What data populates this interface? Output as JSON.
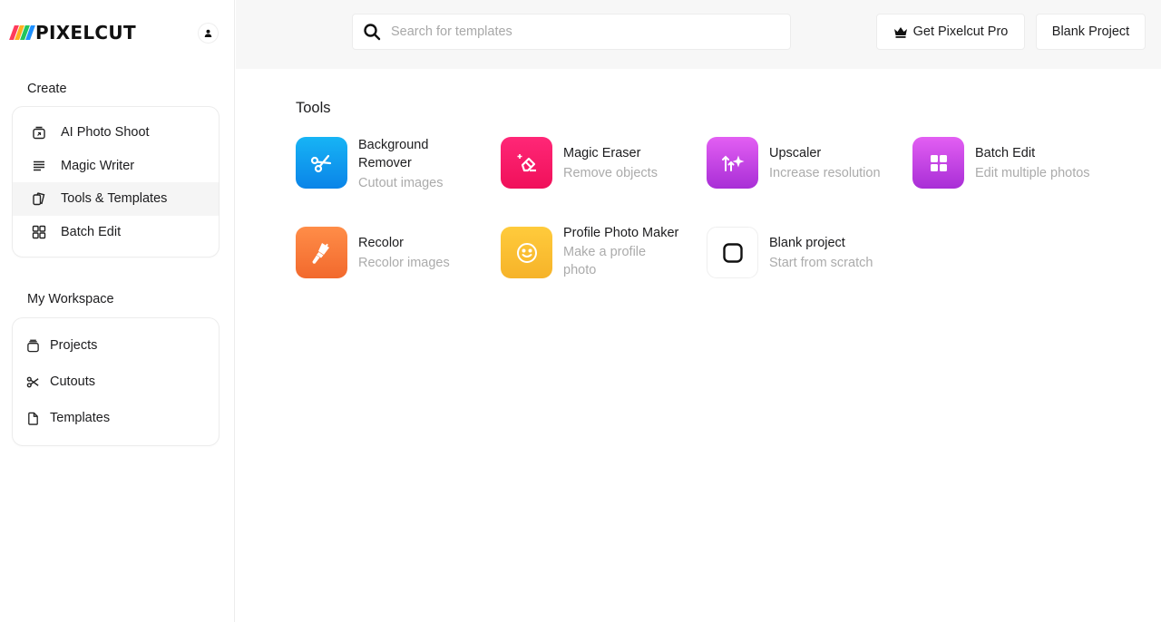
{
  "brand": {
    "name": "PIXELCUT",
    "stripe_colors": [
      "#ff3b5c",
      "#ffb020",
      "#22c55e",
      "#1e90ff"
    ]
  },
  "account": {
    "icon": "user-icon"
  },
  "sidebar": {
    "create_label": "Create",
    "create_items": [
      {
        "label": "AI Photo Shoot",
        "icon": "photo-shoot-icon",
        "active": false
      },
      {
        "label": "Magic Writer",
        "icon": "text-lines-icon",
        "active": false
      },
      {
        "label": "Tools & Templates",
        "icon": "cards-icon",
        "active": true
      },
      {
        "label": "Batch Edit",
        "icon": "grid-icon",
        "active": false
      }
    ],
    "workspace_label": "My Workspace",
    "workspace_items": [
      {
        "label": "Projects",
        "icon": "folder-stack-icon"
      },
      {
        "label": "Cutouts",
        "icon": "scissors-icon"
      },
      {
        "label": "Templates",
        "icon": "document-icon"
      }
    ]
  },
  "header": {
    "search_placeholder": "Search for templates",
    "search_value": "",
    "pro_button": "Get Pixelcut Pro",
    "blank_button": "Blank Project"
  },
  "main": {
    "section_title": "Tools",
    "tools": [
      {
        "name": "Background Remover",
        "desc": "Cutout images",
        "icon": "scissors-icon",
        "colors": [
          "#17b4f5",
          "#0a84e8"
        ]
      },
      {
        "name": "Magic Eraser",
        "desc": "Remove objects",
        "icon": "eraser-icon",
        "colors": [
          "#ff1f70",
          "#f0105a"
        ]
      },
      {
        "name": "Upscaler",
        "desc": "Increase resolution",
        "icon": "upscale-icon",
        "colors": [
          "#e05cf2",
          "#a92fd8"
        ]
      },
      {
        "name": "Batch Edit",
        "desc": "Edit multiple photos",
        "icon": "grid-icon",
        "colors": [
          "#e05cf2",
          "#a92fd8"
        ]
      },
      {
        "name": "Recolor",
        "desc": "Recolor images",
        "icon": "paint-brush-icon",
        "colors": [
          "#ff8a45",
          "#f26a2e"
        ]
      },
      {
        "name": "Profile Photo Maker",
        "desc": "Make a profile photo",
        "icon": "smiley-icon",
        "colors": [
          "#ffca3a",
          "#f7b52a"
        ]
      },
      {
        "name": "Blank project",
        "desc": "Start from scratch",
        "icon": "rounded-square-icon",
        "colors": [
          "#ffffff",
          "#ffffff"
        ]
      }
    ]
  }
}
